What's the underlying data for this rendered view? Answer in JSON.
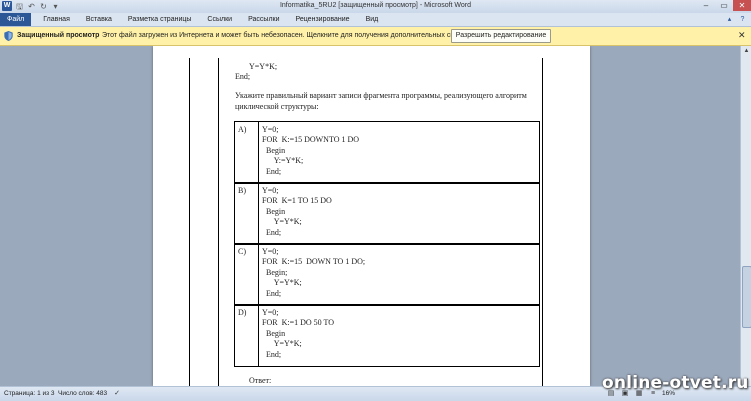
{
  "window": {
    "title": "Informatika_5RU2 [защищенный просмотр] - Microsoft Word",
    "app_icon": "W",
    "controls": {
      "minimize": "–",
      "maximize": "▭",
      "close": "✕"
    }
  },
  "ribbon": {
    "tabs": [
      {
        "label": "Файл"
      },
      {
        "label": "Главная"
      },
      {
        "label": "Вставка"
      },
      {
        "label": "Разметка страницы"
      },
      {
        "label": "Ссылки"
      },
      {
        "label": "Рассылки"
      },
      {
        "label": "Рецензирование"
      },
      {
        "label": "Вид"
      }
    ]
  },
  "protected_view": {
    "title": "Защищенный просмотр",
    "message": "Этот файл загружен из Интернета и может быть небезопасен. Щелкните для получения дополнительных сведений.",
    "button": "Разрешить редактирование",
    "close": "✕"
  },
  "document": {
    "top_code": [
      "Y=Y*K;",
      "End;"
    ],
    "question": "Укажите правильный вариант записи фрагмента программы, реализующего алгоритм циклической структуры:",
    "options": [
      {
        "letter": "A)",
        "code": "Y=0;\nFOR  K:=15 DOWNTO 1 DO\n  Begin\n      Y:=Y*K;\n  End;"
      },
      {
        "letter": "B)",
        "code": "Y=0;\nFOR  K=1 TO 15 DO\n  Begin\n      Y=Y*K;\n  End;"
      },
      {
        "letter": "C)",
        "code": "Y=0;\nFOR  K:=15  DOWN TO 1 DO;\n  Begin;\n      Y=Y*K;\n  End;"
      },
      {
        "letter": "D)",
        "code": "Y=0;\nFOR  K:=1 DO 50 TO\n  Begin\n      Y=Y*K;\n  End;"
      }
    ],
    "answer_label": "Ответ:"
  },
  "statusbar": {
    "page": "Страница: 1 из 3",
    "words": "Число слов: 483",
    "zoom": "16%"
  },
  "watermark": "online-otvet.ru"
}
